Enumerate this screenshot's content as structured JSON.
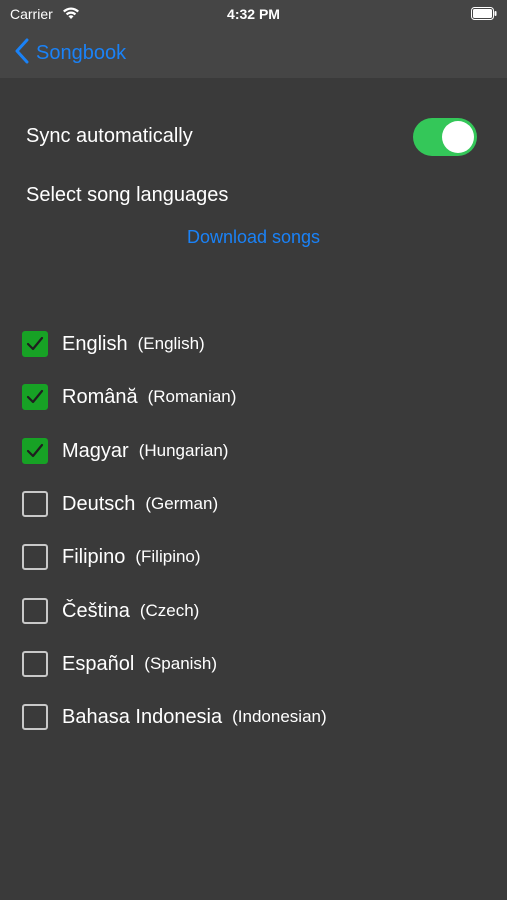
{
  "status_bar": {
    "carrier": "Carrier",
    "time": "4:32 PM"
  },
  "nav": {
    "back_label": "Songbook"
  },
  "settings": {
    "sync_label": "Sync automatically",
    "sync_on": true,
    "select_label": "Select song languages",
    "download_label": "Download songs"
  },
  "languages": [
    {
      "native": "English",
      "english": "(English)",
      "checked": true
    },
    {
      "native": "Română",
      "english": "(Romanian)",
      "checked": true
    },
    {
      "native": "Magyar",
      "english": "(Hungarian)",
      "checked": true
    },
    {
      "native": "Deutsch",
      "english": "(German)",
      "checked": false
    },
    {
      "native": "Filipino",
      "english": "(Filipino)",
      "checked": false
    },
    {
      "native": "Čeština",
      "english": "(Czech)",
      "checked": false
    },
    {
      "native": "Español",
      "english": "(Spanish)",
      "checked": false
    },
    {
      "native": "Bahasa Indonesia",
      "english": "(Indonesian)",
      "checked": false
    }
  ],
  "colors": {
    "accent_blue": "#1a82f7",
    "toggle_green": "#34c759",
    "checkbox_green": "#17a225",
    "background": "#3a3a3a",
    "bar": "#454545"
  }
}
